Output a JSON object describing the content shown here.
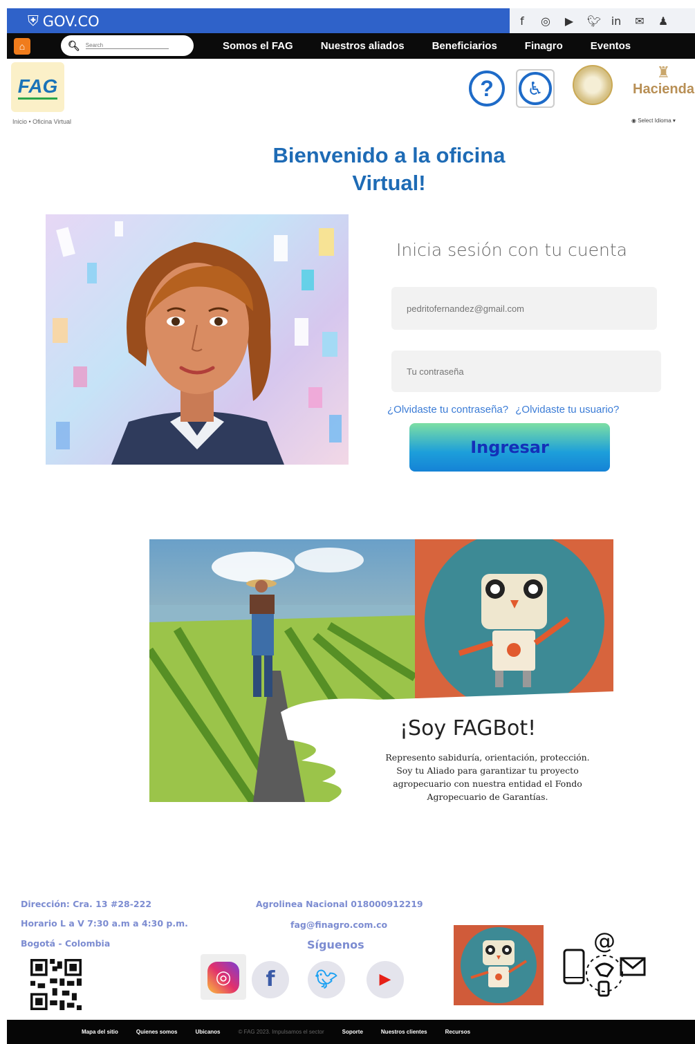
{
  "topbar": {
    "logo_text": "GOV.CO",
    "social_icons": [
      "facebook-icon",
      "instagram-icon",
      "youtube-icon",
      "twitter-icon",
      "linkedin-icon",
      "mail-icon",
      "user-icon"
    ]
  },
  "nav": {
    "search_placeholder": "Search",
    "items": [
      "Somos el FAG",
      "Nuestros aliados",
      "Beneficiarios",
      "Finagro",
      "Eventos"
    ]
  },
  "header": {
    "logo_text": "FAG",
    "help_symbol": "?",
    "hacienda_label": "Hacienda",
    "breadcrumb": "Inicio • Oficina Virtual",
    "language_select": "Select Idioma"
  },
  "welcome": {
    "line1": "Bienvenido a la oficina",
    "line2": "Virtual!"
  },
  "login": {
    "title": "Inicia sesión con tu cuenta",
    "email_placeholder": "pedritofernandez@gmail.com",
    "password_placeholder": "Tu contraseña",
    "forgot_password": "¿Olvidaste tu contraseña?",
    "forgot_user": "¿Olvidaste tu usuario?",
    "submit": "Ingresar"
  },
  "fagbot": {
    "title": "¡Soy FAGBot!",
    "line1": "Represento sabiduría, orientación, protección.",
    "line2": "Soy tu Aliado para garantizar tu proyecto",
    "line3": "agropecuario con nuestra entidad el Fondo",
    "line4": "Agropecuario de Garantías."
  },
  "footer": {
    "address": "Dirección: Cra. 13 #28-222",
    "hours": "Horario L a V 7:30 a.m a 4:30 p.m.",
    "city": "Bogotá - Colombia",
    "hotline": "Agrolinea Nacional 018000912219",
    "email": "fag@finagro.com.co",
    "follow": "Síguenos",
    "colors": {
      "instagram": "#e1306c",
      "facebook": "#1877f2",
      "twitter": "#1da1f2",
      "youtube": "#e62117"
    }
  },
  "bottom_links": [
    "Mapa del sitio",
    "Quienes somos",
    "Ubicanos",
    "© FAG 2023. Impulsamos el sector",
    "Soporte",
    "Nuestros clientes",
    "Recursos"
  ]
}
